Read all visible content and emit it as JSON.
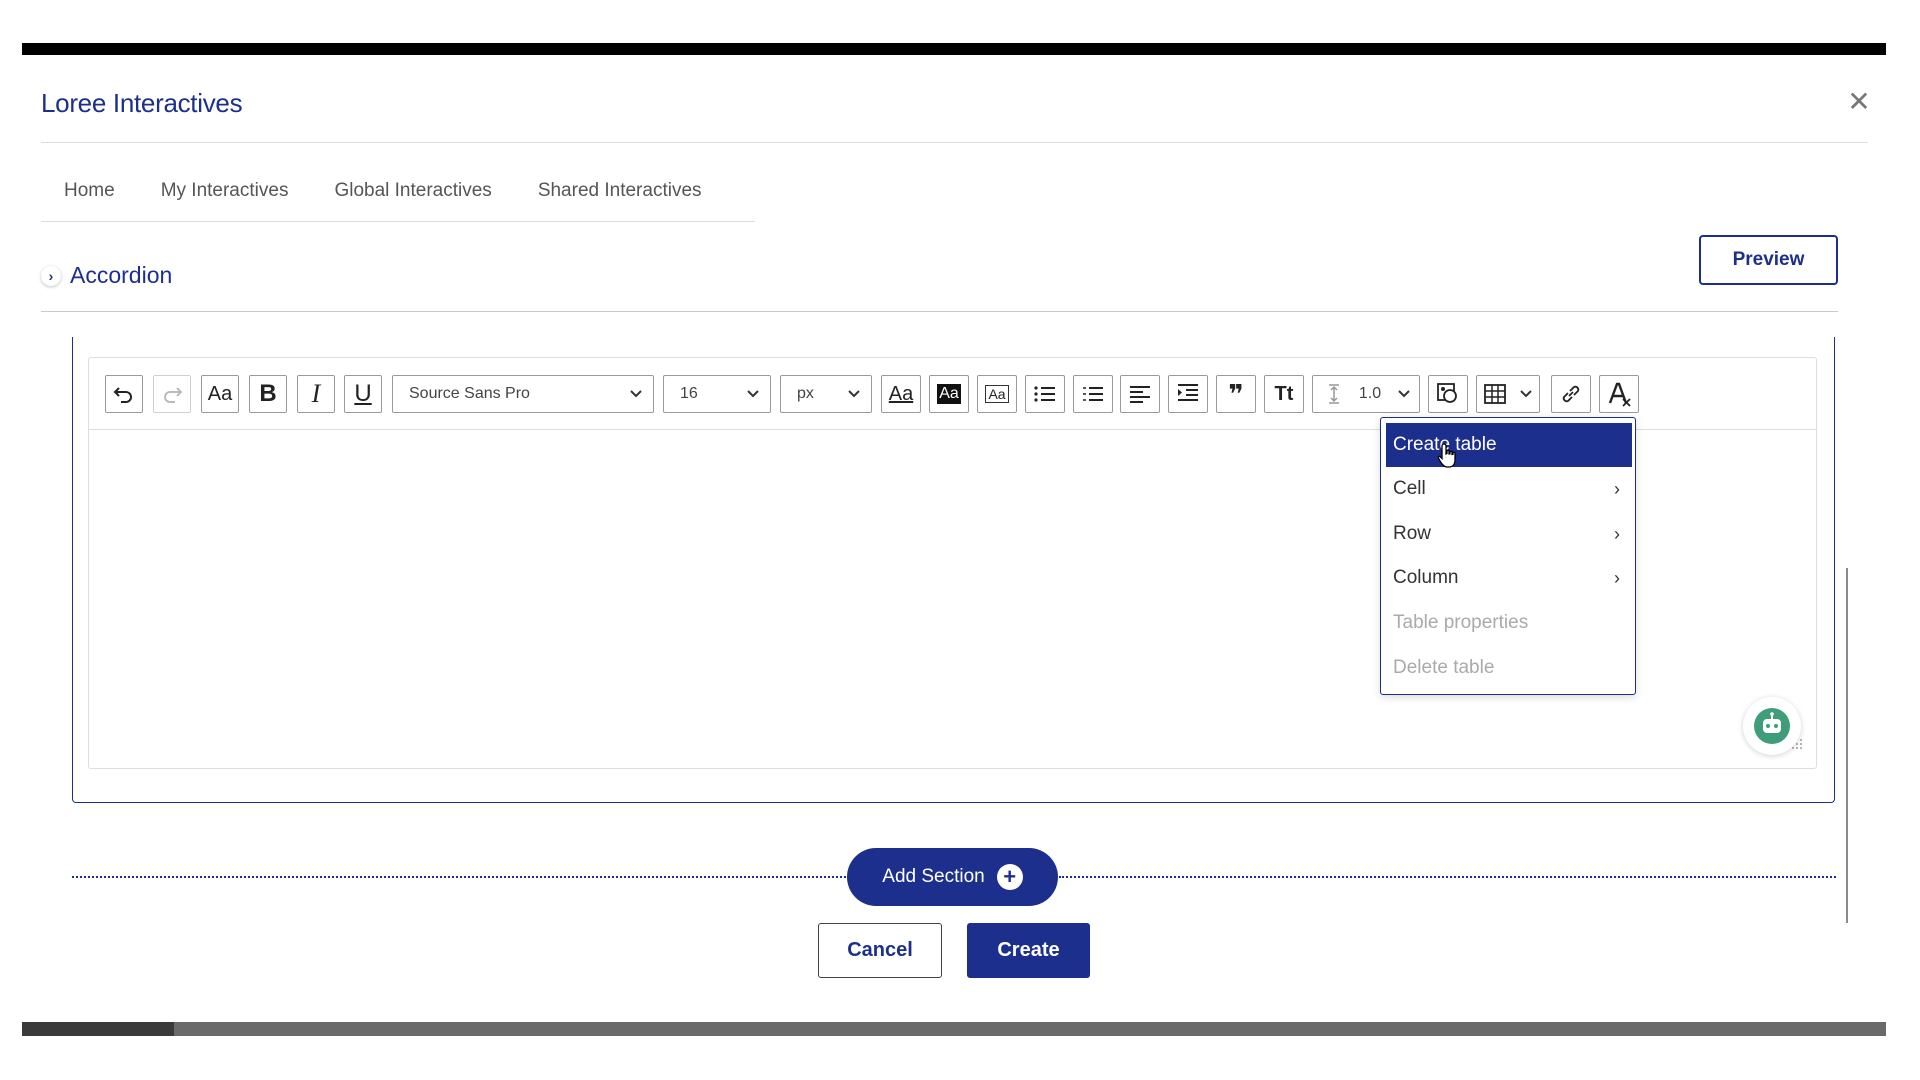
{
  "window": {
    "title": "Loree Interactives",
    "close_symbol": "✕"
  },
  "nav": {
    "tabs": [
      {
        "label": "Home"
      },
      {
        "label": "My Interactives"
      },
      {
        "label": "Global Interactives"
      },
      {
        "label": "Shared Interactives"
      }
    ]
  },
  "header": {
    "accordion_label": "Accordion",
    "chevron": "›",
    "preview_label": "Preview"
  },
  "toolbar": {
    "undo_icon": "undo-icon",
    "redo_icon": "redo-icon",
    "font_case_label": "Aa",
    "bold_label": "B",
    "italic_label": "I",
    "underline_label": "U",
    "font_family": "Source Sans Pro",
    "font_size": "16",
    "font_unit": "px",
    "text_color_label": "Aa",
    "highlight_label": "Aa",
    "bordered_label": "Aa",
    "quote_label": "❞",
    "tt_label": "Tt",
    "line_height": "1.0",
    "caret": "⌄"
  },
  "table_menu": {
    "items": [
      {
        "label": "Create table",
        "arrow": "",
        "state": "active"
      },
      {
        "label": "Cell",
        "arrow": "›",
        "state": "normal"
      },
      {
        "label": "Row",
        "arrow": "›",
        "state": "normal"
      },
      {
        "label": "Column",
        "arrow": "›",
        "state": "normal"
      },
      {
        "label": "Table properties",
        "arrow": "",
        "state": "disabled"
      },
      {
        "label": "Delete table",
        "arrow": "",
        "state": "disabled"
      }
    ]
  },
  "footer": {
    "add_section_label": "Add Section",
    "add_section_plus": "+",
    "cancel_label": "Cancel",
    "create_label": "Create"
  },
  "colors": {
    "brand": "#1d2f8c",
    "border": "#dcdcdc",
    "disabled_text": "#aaaaaa"
  }
}
